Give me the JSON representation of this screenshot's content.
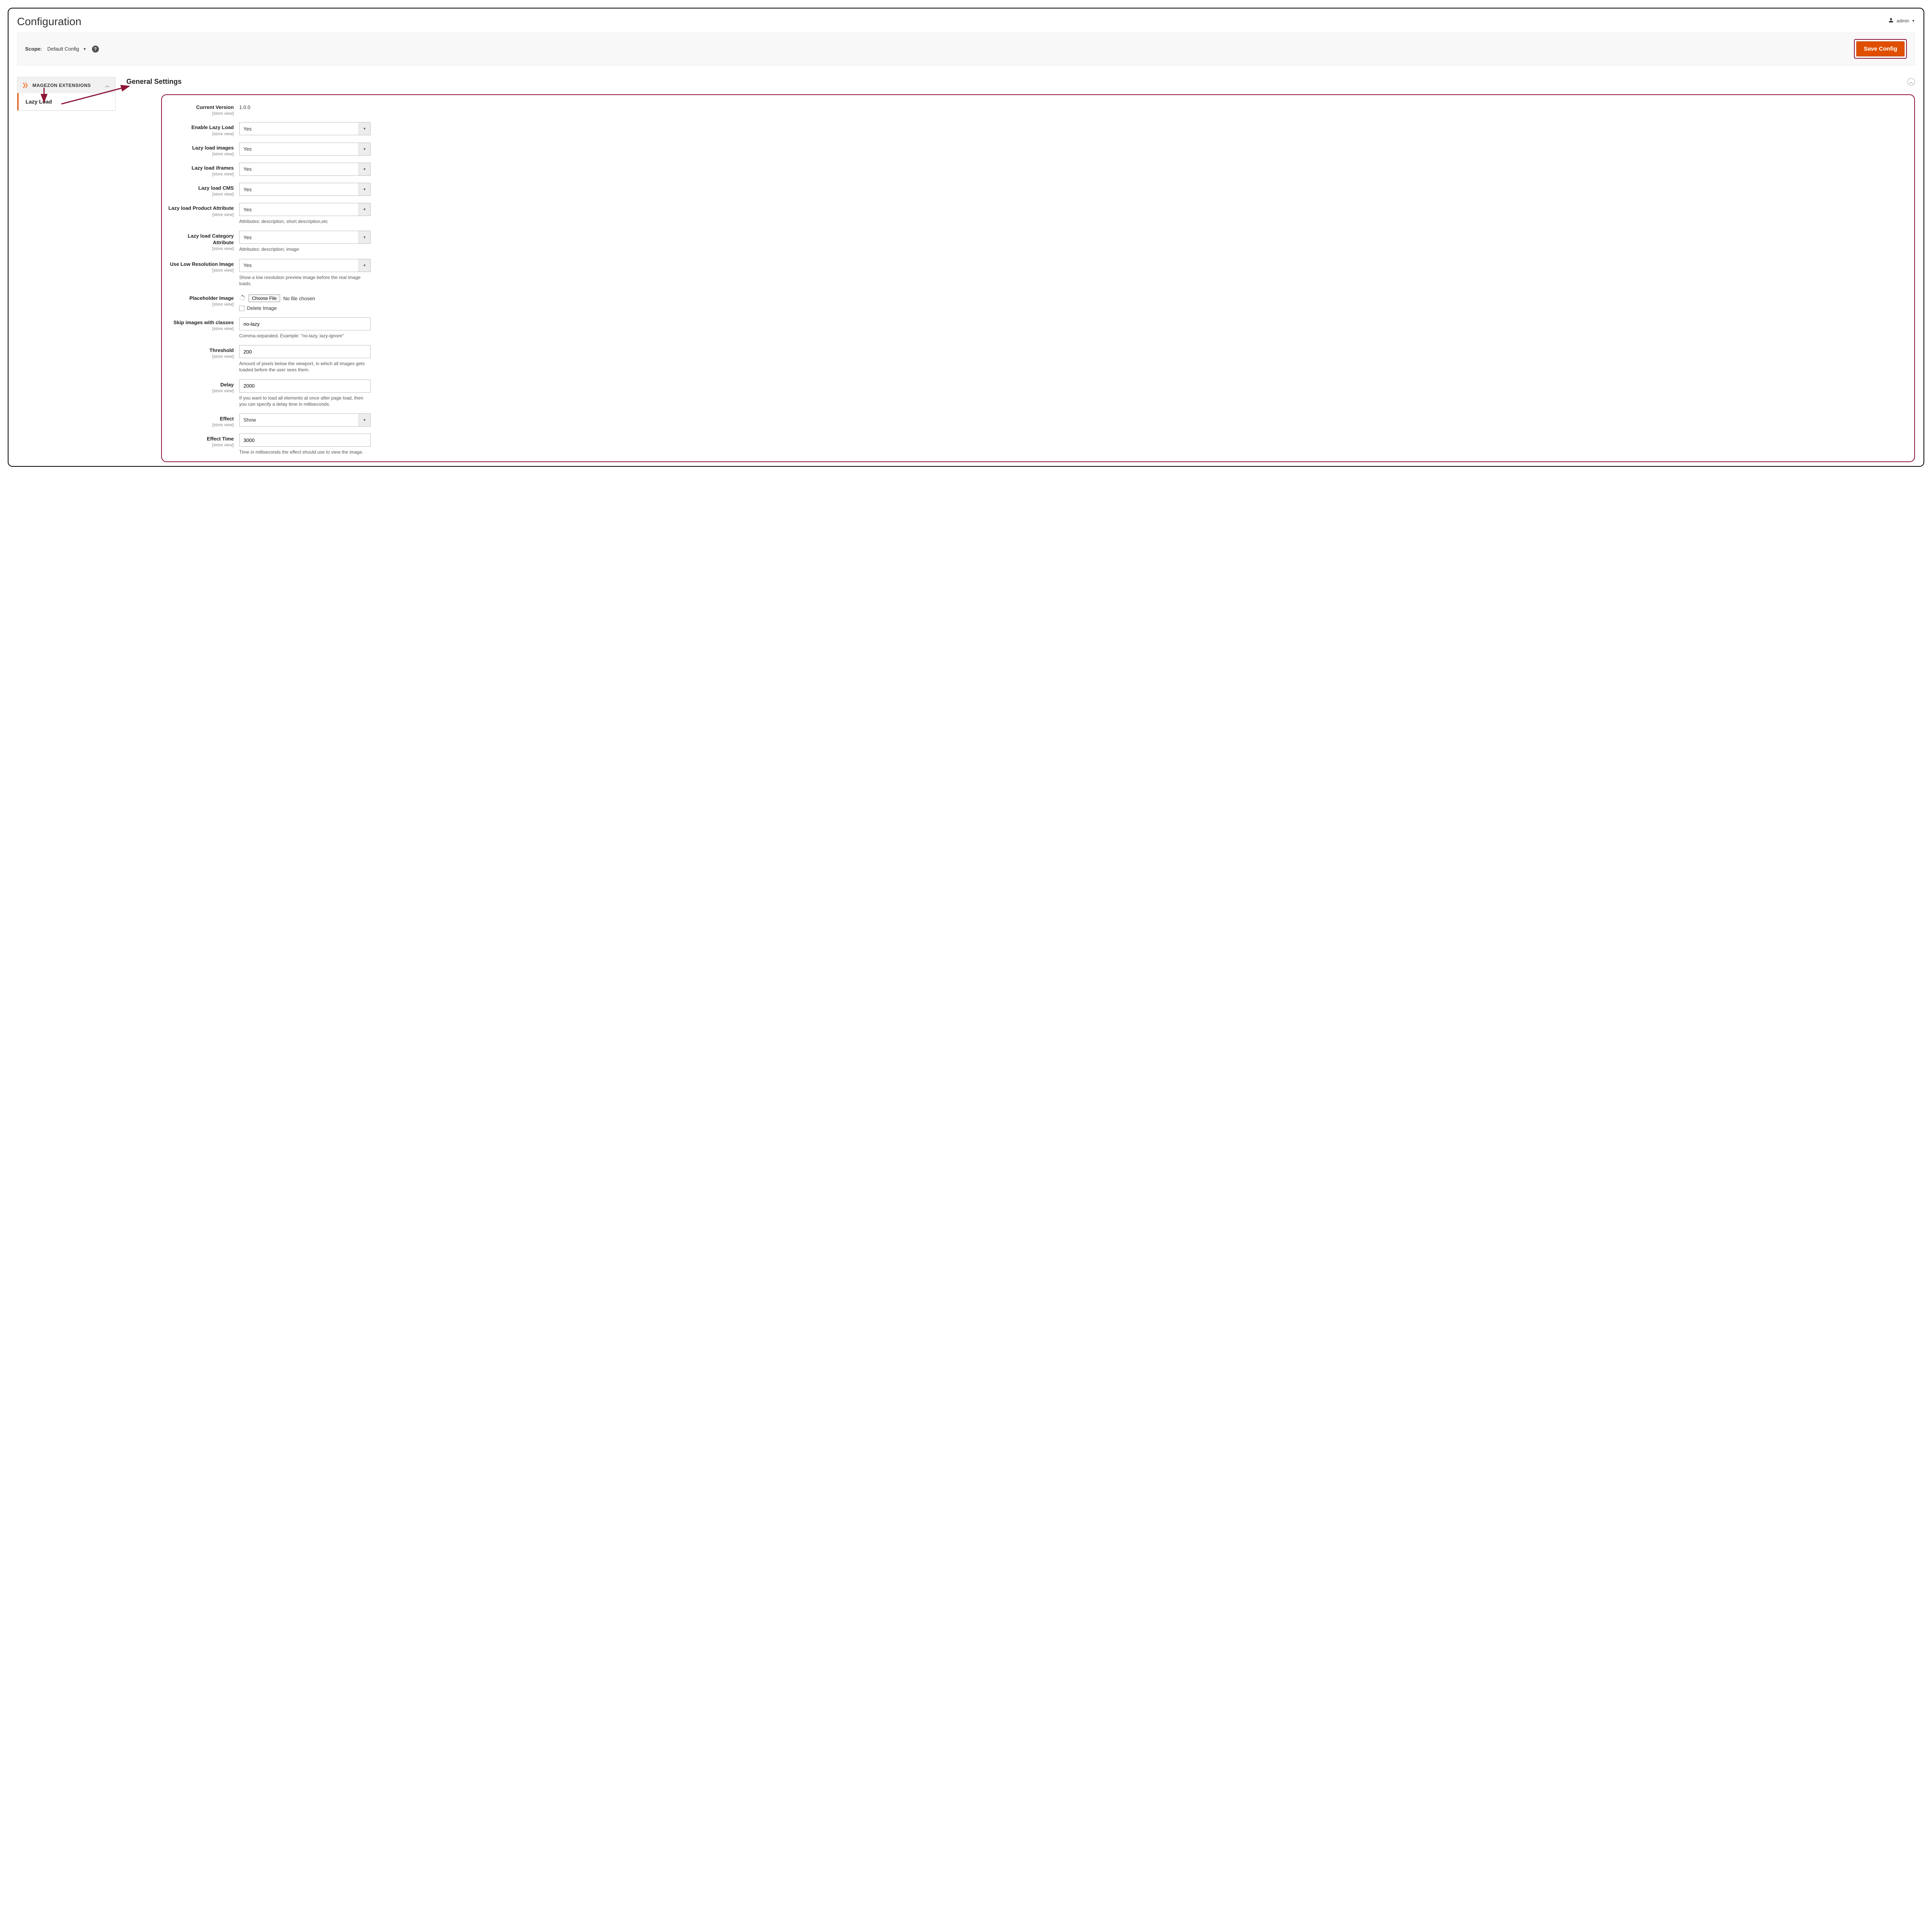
{
  "page": {
    "title": "Configuration"
  },
  "user": {
    "name": "admin"
  },
  "scope": {
    "label": "Scope:",
    "value": "Default Config"
  },
  "actions": {
    "save": "Save Config"
  },
  "sidebar": {
    "section_title": "MAGEZON EXTENSIONS",
    "items": [
      {
        "label": "Lazy Load"
      }
    ]
  },
  "section": {
    "heading": "General Settings"
  },
  "scope_note": "[store view]",
  "fields": {
    "version": {
      "label": "Current Version",
      "value": "1.0.0"
    },
    "enable": {
      "label": "Enable Lazy Load",
      "value": "Yes"
    },
    "images": {
      "label": "Lazy load images",
      "value": "Yes"
    },
    "iframes": {
      "label": "Lazy load iframes",
      "value": "Yes"
    },
    "cms": {
      "label": "Lazy load CMS",
      "value": "Yes"
    },
    "product_attr": {
      "label": "Lazy load Product Attribute",
      "value": "Yes",
      "note": "Attributes: description, short description,etc"
    },
    "category_attr": {
      "label": "Lazy load Category Attribute",
      "value": "Yes",
      "note": "Attributes: description, image"
    },
    "low_res": {
      "label": "Use Low Resolution Image",
      "value": "Yes",
      "note": "Show a low resolution preview image before the real image loads."
    },
    "placeholder": {
      "label": "Placeholder Image",
      "choose": "Choose File",
      "no_file": "No file chosen",
      "delete_label": "Delete Image"
    },
    "skip_classes": {
      "label": "Skip images with classes",
      "value": "no-lazy",
      "note": "Comma-separated. Example: \"no-lazy, lazy-ignore\""
    },
    "threshold": {
      "label": "Threshold",
      "value": "200",
      "note": "Amount of pixels below the viewport, in which all images gets loaded before the user sees them."
    },
    "delay": {
      "label": "Delay",
      "value": "2000",
      "note": "If you want to load all elements at once after page load, then you can specify a delay time in milliseconds."
    },
    "effect": {
      "label": "Effect",
      "value": "Show"
    },
    "effect_time": {
      "label": "Effect Time",
      "value": "3000",
      "note": "Time in milliseconds the effect should use to view the image."
    }
  }
}
